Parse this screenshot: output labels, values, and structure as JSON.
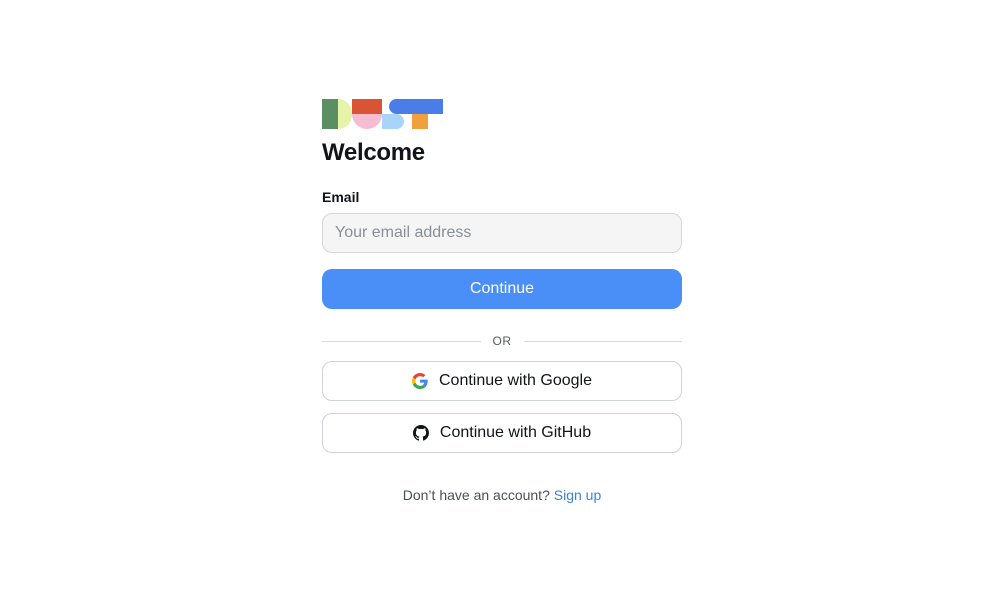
{
  "brand": {
    "logo_name": "dust-logo",
    "colors": [
      "#5a8f64",
      "#e6f3a8",
      "#d95434",
      "#f6bcd1",
      "#4a7de8",
      "#a8d4f7",
      "#f0a13e"
    ]
  },
  "page": {
    "title": "Welcome"
  },
  "form": {
    "email_label": "Email",
    "email_placeholder": "Your email address",
    "email_value": "",
    "continue_label": "Continue"
  },
  "divider": {
    "text": "OR"
  },
  "oauth": {
    "google_label": "Continue with Google",
    "google_icon": "google-icon",
    "github_label": "Continue with GitHub",
    "github_icon": "github-icon"
  },
  "footer": {
    "prompt": "Don’t have an account?",
    "signup_label": "Sign up"
  },
  "theme": {
    "accent": "#4a8ff7",
    "link": "#3b82e0"
  }
}
